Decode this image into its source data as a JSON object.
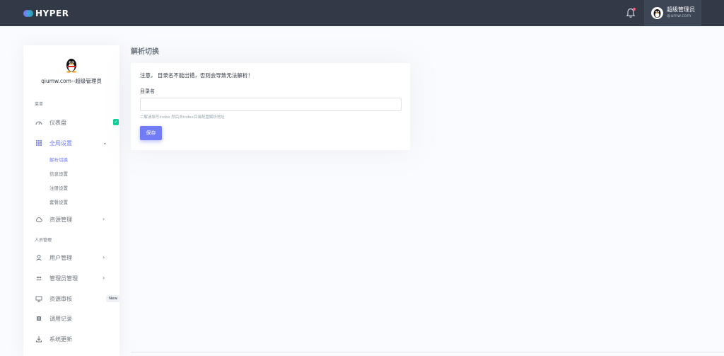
{
  "topbar": {
    "logo_text": "HYPER",
    "user_name": "超级管理员",
    "user_site": "qiumw.com"
  },
  "sidebar": {
    "username": "qiumw.com--超级管理员",
    "section_menu": "菜单",
    "dashboard": "仪表盘",
    "global_settings": "全局设置",
    "sub_items": [
      "解析切换",
      "信息设置",
      "注册设置",
      "套餐设置"
    ],
    "resource_mgmt": "资源管理",
    "section_people": "人员管理",
    "user_mgmt": "用户管理",
    "admin_mgmt": "管理员管理",
    "resource_review": "资源审核",
    "new_badge": "New",
    "call_log": "调用记录",
    "system_update": "系统更新"
  },
  "main": {
    "page_title": "解析切换",
    "notice": "注意， 目录名不能出错，否则会导致无法解析！",
    "field_label": "目录名",
    "field_value": "",
    "field_placeholder": "",
    "help_text": "二解请填写index 然后去index目录配置解析地址",
    "save_label": "保存"
  },
  "colors": {
    "primary": "#727cf5",
    "topbar": "#313a46",
    "success": "#0acf97",
    "danger": "#fa5c7c"
  },
  "icons": [
    "logo-icon",
    "bell-icon",
    "avatar",
    "dashboard-icon",
    "grid-icon",
    "cloud-icon",
    "user-icon",
    "users-icon",
    "monitor-icon",
    "log-icon",
    "download-icon",
    "chevron-icon"
  ]
}
